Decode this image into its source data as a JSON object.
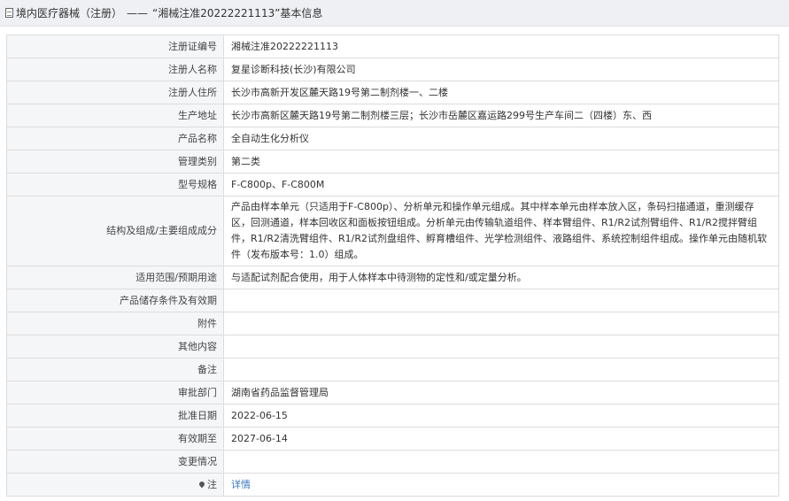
{
  "header": {
    "breadcrumb": "境内医疗器械（注册）",
    "separator": "——",
    "title": "“湘械注准20222221113”基本信息"
  },
  "rows": [
    {
      "label": "注册证编号",
      "value": "湘械注准20222221113"
    },
    {
      "label": "注册人名称",
      "value": "复星诊断科技(长沙)有限公司"
    },
    {
      "label": "注册人住所",
      "value": "长沙市高新开发区麓天路19号第二制剂楼一、二楼"
    },
    {
      "label": "生产地址",
      "value": "长沙市高新区麓天路19号第二制剂楼三层；长沙市岳麓区嘉运路299号生产车间二（四楼）东、西"
    },
    {
      "label": "产品名称",
      "value": "全自动生化分析仪"
    },
    {
      "label": "管理类别",
      "value": "第二类"
    },
    {
      "label": "型号规格",
      "value": "F-C800p、F-C800M"
    },
    {
      "label": "结构及组成/主要组成成分",
      "value": "产品由样本单元（只适用于F-C800p）、分析单元和操作单元组成。其中样本单元由样本放入区，条码扫描通道，重测缓存区，回测通道，样本回收区和面板按钮组成。分析单元由传输轨道组件、样本臂组件、R1/R2试剂臂组件、R1/R2搅拌臂组件，R1/R2清洗臂组件、R1/R2试剂盘组件、孵育槽组件、光学检测组件、液路组件、系统控制组件组成。操作单元由随机软件（发布版本号：1.0）组成。"
    },
    {
      "label": "适用范围/预期用途",
      "value": "与适配试剂配合使用，用于人体样本中待测物的定性和/或定量分析。"
    },
    {
      "label": "产品储存条件及有效期",
      "value": ""
    },
    {
      "label": "附件",
      "value": ""
    },
    {
      "label": "其他内容",
      "value": ""
    },
    {
      "label": "备注",
      "value": ""
    },
    {
      "label": "审批部门",
      "value": "湖南省药品监督管理局"
    },
    {
      "label": "批准日期",
      "value": "2022-06-15"
    },
    {
      "label": "有效期至",
      "value": "2027-06-14"
    },
    {
      "label": "变更情况",
      "value": ""
    }
  ],
  "note_row": {
    "label": "注",
    "link": "详情",
    "icon": "pin-icon"
  }
}
